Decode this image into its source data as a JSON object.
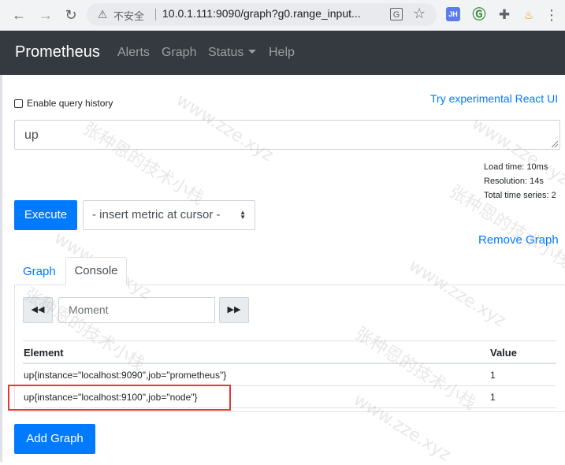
{
  "browser": {
    "insecure_label": "不安全",
    "url": "10.0.1.111:9090/graph?g0.range_input...",
    "ext_jh": "JH"
  },
  "navbar": {
    "brand": "Prometheus",
    "links": [
      "Alerts",
      "Graph",
      "Status",
      "Help"
    ]
  },
  "page": {
    "enable_history_label": "Enable query history",
    "react_link": "Try experimental React UI",
    "expression": "up",
    "stats": {
      "load_time": "Load time: 10ms",
      "resolution": "Resolution: 14s",
      "total_series": "Total time series: 2"
    },
    "execute_label": "Execute",
    "insert_metric": "- insert metric at cursor -",
    "remove_graph": "Remove Graph",
    "tabs": [
      "Graph",
      "Console"
    ],
    "active_tab": "Console",
    "moment_placeholder": "Moment",
    "table": {
      "headers": [
        "Element",
        "Value"
      ],
      "rows": [
        {
          "element": "up{instance=\"localhost:9090\",job=\"prometheus\"}",
          "value": "1"
        },
        {
          "element": "up{instance=\"localhost:9100\",job=\"node\"}",
          "value": "1"
        }
      ]
    },
    "add_graph": "Add Graph"
  },
  "watermarks": [
    "www.zze.xyz",
    "张种恩的技术小栈"
  ],
  "colors": {
    "navbar_bg": "#343a40",
    "primary": "#007bff",
    "highlight": "#e53935"
  }
}
